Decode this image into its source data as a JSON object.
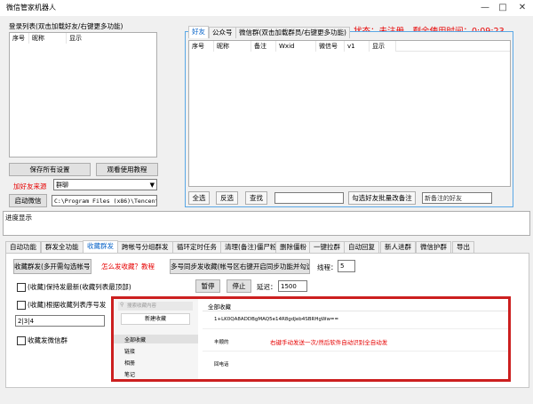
{
  "window": {
    "title": "微信管家机器人"
  },
  "login_list": {
    "title": "登录列表(双击加载好友/右键更多功能)",
    "columns": [
      "序号",
      "昵称",
      "显示"
    ]
  },
  "left_panel": {
    "save_all": "保存所有设置",
    "view_tutorial": "观看使用教程",
    "add_friend_source_label": "加好友来源",
    "add_friend_source_value": "群聊",
    "start_wechat": "启动微信",
    "wechat_path": "C:\\Program Files (x86)\\Tencent\\We"
  },
  "status": {
    "text": "状态：未注册，剩余使用时间：0:09:23",
    "color": "#e60000"
  },
  "friends_panel": {
    "tabs": [
      "好友",
      "公众号",
      "微信群(双击加载群员/右键更多功能)"
    ],
    "active_tab": 0,
    "columns": [
      "序号",
      "昵称",
      "备注",
      "Wxid",
      "微信号",
      "v1",
      "显示"
    ],
    "select_all": "全选",
    "invert": "反选",
    "search": "查找",
    "search_value": "",
    "batch_remark": "勾选好友批量改备注",
    "new_remark_placeholder": "新备注的好友"
  },
  "progress": {
    "label": "进度显示"
  },
  "main_tabs": [
    {
      "label": "自动功能"
    },
    {
      "label": "群发全功能"
    },
    {
      "label": "收藏群发"
    },
    {
      "label": "跨帐号分组群发"
    },
    {
      "label": "循环定时任务"
    },
    {
      "label": "清理(备注)僵尸粉"
    },
    {
      "label": "删除僵粉"
    },
    {
      "label": "一键拉群"
    },
    {
      "label": "自动回复"
    },
    {
      "label": "新人进群"
    },
    {
      "label": "微信护群"
    },
    {
      "label": "导出"
    }
  ],
  "active_main_tab": 2,
  "fav_panel": {
    "fav_broadcast_btn": "收藏群发(多开需勾选帐号)",
    "how_to_link": "怎么发收藏？教程",
    "multi_sync_btn": "多号同步发收藏(帐号区右键开启同步功能并勾选)",
    "thread_label": "线程：",
    "thread_value": "5",
    "keep_latest_label": "(收藏)保持发最新(收藏列表最顶部)",
    "by_index_label": "(收藏)根据收藏列表序号发",
    "index_value": "2|3|4",
    "to_groups_label": "收藏发微信群",
    "pause_btn": "暂停",
    "stop_btn": "停止",
    "delay_label": "延迟：",
    "delay_value": "1500"
  },
  "preview": {
    "sidebar_search": "搜索收藏内容",
    "new_note": "新建收藏",
    "side_items": [
      "全部收藏",
      "链接",
      "相册",
      "笔记"
    ],
    "header": "全部收藏",
    "items": [
      "1+LK0QA8ADDBgMAQ5e14R8gdJeb4SBRHgWw==",
      "丰顺的",
      "回电话"
    ],
    "annotation": "右键手动发送一次/然后软件自动识别全自动发",
    "border_color": "#cc1f1f",
    "annotation_color": "#e60000"
  }
}
